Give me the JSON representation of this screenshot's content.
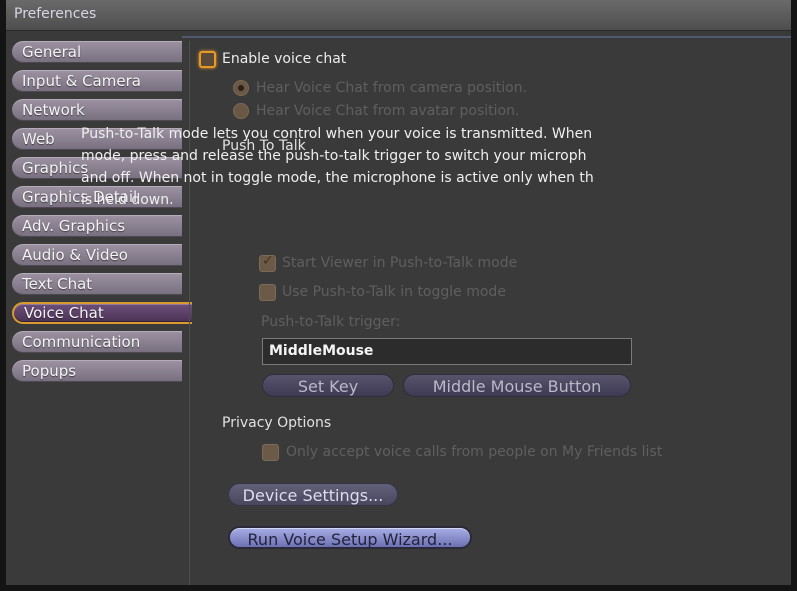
{
  "window": {
    "title": "Preferences"
  },
  "sidebar": {
    "items": [
      {
        "label": "General"
      },
      {
        "label": "Input & Camera"
      },
      {
        "label": "Network"
      },
      {
        "label": "Web"
      },
      {
        "label": "Graphics"
      },
      {
        "label": "Graphics Detail"
      },
      {
        "label": "Adv. Graphics"
      },
      {
        "label": "Audio & Video"
      },
      {
        "label": "Text Chat"
      },
      {
        "label": "Voice Chat"
      },
      {
        "label": "Communication"
      },
      {
        "label": "Popups"
      }
    ],
    "selected": "Voice Chat"
  },
  "voice": {
    "enable_label": "Enable voice chat",
    "enable_checked": false,
    "hear_camera_label": "Hear Voice Chat from camera position.",
    "hear_avatar_label": "Hear Voice Chat from avatar position.",
    "hear_camera_selected": true
  },
  "ptt": {
    "heading": "Push To Talk",
    "description_lines": [
      "Push-to-Talk mode lets you control when your voice is transmitted. When",
      "mode, press and release the push-to-talk trigger to switch your microph",
      "and off. When not in toggle mode, the microphone is active only when th",
      "is held down."
    ],
    "start_in_ptt_label": "Start Viewer in Push-to-Talk mode",
    "start_in_ptt_checked": true,
    "toggle_mode_label": "Use Push-to-Talk in toggle mode",
    "toggle_mode_checked": false,
    "trigger_label": "Push-to-Talk trigger:",
    "trigger_value": "MiddleMouse",
    "set_key_label": "Set Key",
    "middle_mouse_label": "Middle Mouse Button"
  },
  "privacy": {
    "heading": "Privacy Options",
    "friends_only_label": "Only accept voice calls from people on My Friends list",
    "friends_only_checked": false
  },
  "buttons": {
    "device_settings": "Device Settings...",
    "run_wizard": "Run Voice Setup Wizard..."
  },
  "colors": {
    "accent": "#e89a24",
    "selected_tab": "#5c4068",
    "tab": "#8b8291"
  }
}
